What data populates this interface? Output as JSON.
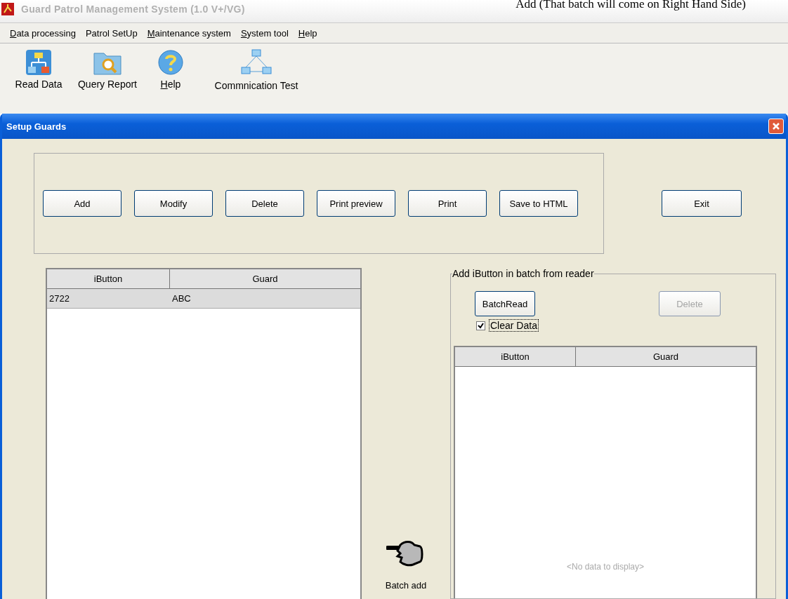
{
  "caption": "Add (That batch will come on Right Hand Side)",
  "app_title": "Guard Patrol Management System (1.0 V+/VG)",
  "menu": [
    {
      "label": "Data processing",
      "underline_first": true
    },
    {
      "label": "Patrol SetUp",
      "underline_first": false
    },
    {
      "label": "Maintenance system",
      "underline_first": true
    },
    {
      "label": "System tool",
      "underline_first": true
    },
    {
      "label": "Help",
      "underline_first": true
    }
  ],
  "toolbar": [
    {
      "label": "Read Data",
      "kind": "read",
      "underline_first": false
    },
    {
      "label": "Query Report",
      "kind": "query",
      "underline_first": false
    },
    {
      "label": "Help",
      "kind": "help",
      "underline_first": true
    },
    {
      "label": "Commnication Test",
      "kind": "network",
      "underline_first": false
    }
  ],
  "dialog": {
    "title": "Setup Guards",
    "buttons": [
      "Add",
      "Modify",
      "Delete",
      "Print preview",
      "Print",
      "Save to HTML"
    ],
    "exit_button": "Exit",
    "table": {
      "columns": [
        "iButton",
        "Guard"
      ],
      "rows": [
        {
          "cells": [
            "2722",
            "ABC"
          ],
          "selected": true
        }
      ]
    },
    "batch_add": "Batch add",
    "batch_group": {
      "title": "Add iButton in batch from reader",
      "buttons": [
        {
          "label": "BatchRead",
          "disabled": false
        },
        {
          "label": "Delete",
          "disabled": true
        }
      ],
      "clear_data": {
        "label": "Clear Data",
        "checked": true
      },
      "table": {
        "columns": [
          "iButton",
          "Guard"
        ],
        "empty_text": "<No data to display>"
      }
    }
  }
}
